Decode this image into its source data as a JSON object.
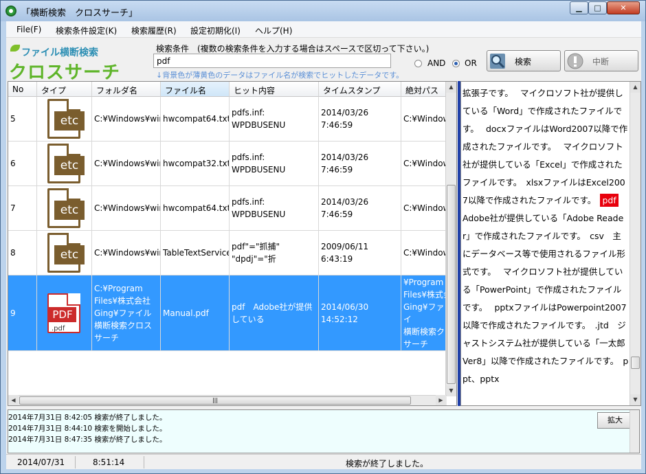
{
  "window": {
    "title": "「横断検索　クロスサーチ」",
    "min_glyph": "▁",
    "max_glyph": "□",
    "close_glyph": "✕"
  },
  "menu": [
    "File(F)",
    "検索条件設定(K)",
    "検索履歴(R)",
    "設定初期化(I)",
    "ヘルプ(H)"
  ],
  "logo": {
    "subtitle": "ファイル横断検索",
    "name": "クロスサーチ"
  },
  "search": {
    "label": "検索条件　(複数の検索条件を入力する場合はスペースで区切って下さい。)",
    "value": "pdf",
    "hint": "↓背景色が薄黄色のデータはファイル名が検索でヒットしたデータです。",
    "mode_and": "AND",
    "mode_or": "OR",
    "selected_mode": "OR",
    "search_button": "検索",
    "stop_button": "中断"
  },
  "results": {
    "columns": [
      "No",
      "タイプ",
      "フォルダ名",
      "ファイル名",
      "ヒット内容",
      "タイムスタンプ",
      "絶対パス"
    ],
    "sorted_column": "ファイル名",
    "rows": [
      {
        "no": "5",
        "icon_label": "etc",
        "folder": "C:¥Windows¥winsxs¥",
        "file": "hwcompat64.txt",
        "hit": "pdfs.inf:\nWPDBUSENU",
        "timestamp": "2014/03/26\n7:46:59",
        "path": "C:¥Windows",
        "selected": false
      },
      {
        "no": "6",
        "icon_label": "etc",
        "folder": "C:¥Windows¥winsxs¥",
        "file": "hwcompat32.txt",
        "hit": "pdfs.inf:\nWPDBUSENU",
        "timestamp": "2014/03/26\n7:46:59",
        "path": "C:¥Windows",
        "selected": false
      },
      {
        "no": "7",
        "icon_label": "etc",
        "folder": "C:¥Windows¥winsxs¥",
        "file": "hwcompat64.txt",
        "hit": "pdfs.inf:\nWPDBUSENU",
        "timestamp": "2014/03/26\n7:46:59",
        "path": "C:¥Windows",
        "selected": false
      },
      {
        "no": "8",
        "icon_label": "etc",
        "folder": "C:¥Windows¥winsxs¥",
        "file": "TableTextService",
        "hit": "pdf\"=\"抓捕\"\n\"dpdj\"=\"折",
        "timestamp": "2009/06/11\n6:43:19",
        "path": "C:¥Windows",
        "selected": false
      },
      {
        "no": "9",
        "icon_label": "PDF",
        "icon_ext": ".pdf",
        "folder": "C:¥Program\nFiles¥株式会社\nGing¥ファイル\n横断検索クロス\nサーチ",
        "file": "Manual.pdf",
        "hit": "pdf　Adobe社が提供\nしている",
        "timestamp": "2014/06/30\n14:52:12",
        "path": "C:¥Program\nFiles¥株式会\nGing¥ファイ\n横断検索ク\nサーチ\n¥Manual.pd",
        "selected": true
      }
    ]
  },
  "preview": {
    "before": "拡張子です。　 マイクロソフト社が提供している「Word」で作成されたファイルです。　 docxファイルはWord2007以降で作成されたファイルです。　 マイクロソフト社が提供している「Excel」で作成されたファイルです。　xlsxファイルはExcel2007以降で作成されたファイルです。　",
    "highlight": "pdf",
    "after": "　Adobe社が提供している「Adobe Reader」で作成されたファイルです。　csv　主にデータベース等で使用されるファイル形式です。　 マイクロソフト社が提供している「PowerPoint」で作成されたファイルです。　 pptxファイルはPowerpoint2007以降で作成されたファイルです。　.jtd　ジャストシステム社が提供している「一太郎Ver8」以降で作成されたファイルです。　ppt、pptx"
  },
  "log": {
    "lines": [
      "2014年7月31日  8:42:05 検索が終了しました。",
      "2014年7月31日  8:44:10 検索を開始しました。",
      "2014年7月31日  8:47:35 検索が終了しました。"
    ],
    "expand_button": "拡大"
  },
  "status": {
    "date": "2014/07/31",
    "time": "8:51:14",
    "message": "検索が終了しました。"
  },
  "colors": {
    "selection": "#3399ff",
    "highlight": "#e8000c",
    "logo_green": "#5fb52a",
    "logo_blue": "#2d8fb4",
    "etc_icon": "#7a5d2e",
    "pdf_icon": "#cc2b2b"
  }
}
